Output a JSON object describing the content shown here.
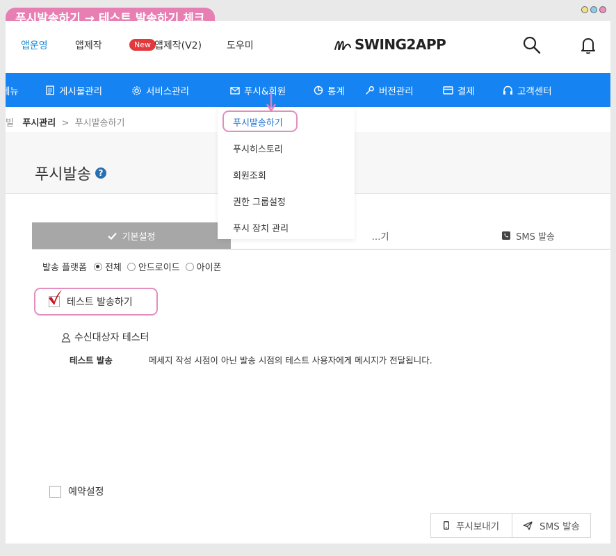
{
  "banner": "푸시발송하기 → 테스트 발송하기 체크",
  "window_dots": [
    {
      "name": "yellow-dot",
      "color": "#f2e08b"
    },
    {
      "name": "blue-dot",
      "color": "#8ccdeb"
    },
    {
      "name": "pink-dot",
      "color": "#ec8fbd"
    }
  ],
  "topnav": {
    "items": [
      "앱운영",
      "앱제작",
      "앱제작(V2)",
      "도우미"
    ],
    "new_badge": "New",
    "logo": "SWING2APP"
  },
  "bluenav": {
    "items": [
      "메뉴",
      "게시물관리",
      "서비스관리",
      "푸시&회원",
      "통계",
      "버전관리",
      "결제",
      "고객센터"
    ]
  },
  "breadcrumb": {
    "prefix": "빌",
    "section": "푸시관리",
    "separator": ">",
    "current": "푸시발송하기"
  },
  "page_title": "푸시발송",
  "help_symbol": "?",
  "dropdown": {
    "items": [
      "푸시발송하기",
      "푸시히스토리",
      "회원조회",
      "권한 그룹설정",
      "푸시 장치 관리"
    ]
  },
  "tabs": [
    {
      "label": "기본설정",
      "icon": "check-icon"
    },
    {
      "label": "…기",
      "icon": ""
    },
    {
      "label": "SMS 발송",
      "icon": "phone-icon"
    }
  ],
  "platform": {
    "label": "발송 플랫폼",
    "options": [
      "전체",
      "안드로이드",
      "아이폰"
    ],
    "selected": "전체"
  },
  "test_send": {
    "label": "테스트 발송하기",
    "checked": true
  },
  "receiver": {
    "label": "수신대상자 테스터"
  },
  "test_row": {
    "label": "테스트 발송",
    "description": "메세지 작성 시점이 아닌 발송 시점의 테스트 사용자에게 메시지가 전달됩니다."
  },
  "reserve": {
    "label": "예약설정"
  },
  "buttons": {
    "push_send": "푸시보내기",
    "sms_send": "SMS 발송"
  },
  "colors": {
    "accent": "#1583f1",
    "highlight": "#e28ec1",
    "banner": "#e87fb3",
    "check": "#d11020"
  }
}
